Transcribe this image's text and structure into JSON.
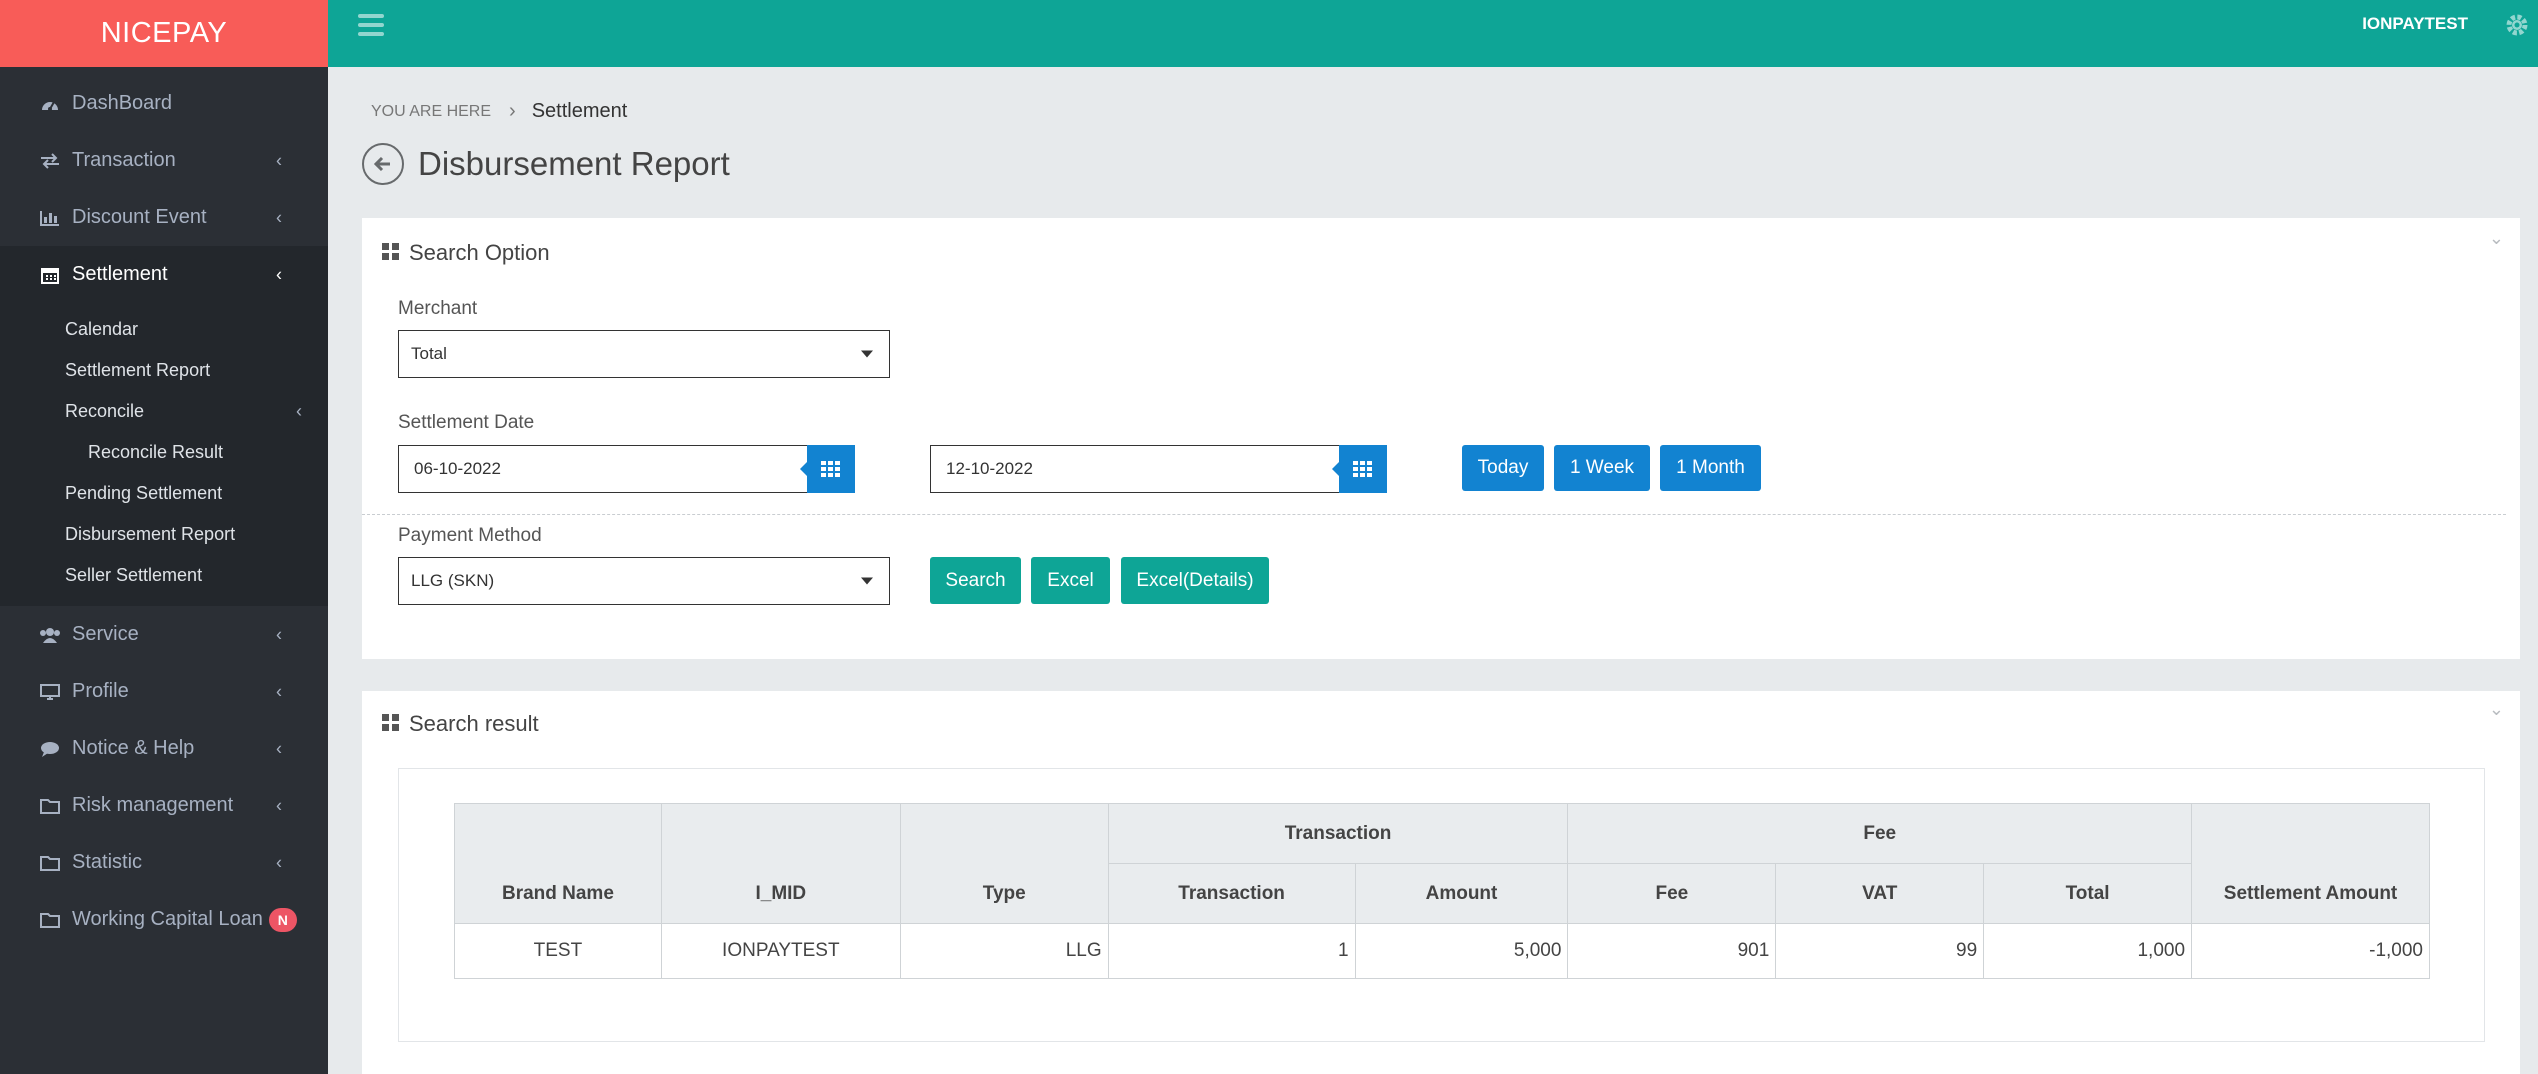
{
  "app": {
    "logo": "NICEPAY",
    "user": "IONPAYTEST"
  },
  "sidebar": {
    "items": [
      {
        "label": "DashBoard",
        "icon": "dashboard-icon"
      },
      {
        "label": "Transaction",
        "icon": "exchange-icon"
      },
      {
        "label": "Discount Event",
        "icon": "bar-chart-icon"
      },
      {
        "label": "Settlement",
        "icon": "calendar-icon"
      },
      {
        "label": "Service",
        "icon": "users-icon"
      },
      {
        "label": "Profile",
        "icon": "desktop-icon"
      },
      {
        "label": "Notice & Help",
        "icon": "comment-icon"
      },
      {
        "label": "Risk management",
        "icon": "folder-icon"
      },
      {
        "label": "Statistic",
        "icon": "folder-icon"
      },
      {
        "label": "Working Capital Loan",
        "icon": "folder-icon",
        "badge": "N"
      }
    ],
    "settlement_sub": [
      {
        "label": "Calendar"
      },
      {
        "label": "Settlement Report"
      },
      {
        "label": "Reconcile"
      },
      {
        "label": "Reconcile Result"
      },
      {
        "label": "Pending Settlement"
      },
      {
        "label": "Disbursement Report"
      },
      {
        "label": "Seller Settlement"
      }
    ]
  },
  "breadcrumb": {
    "prefix": "YOU ARE HERE",
    "current": "Settlement"
  },
  "page": {
    "title": "Disbursement Report"
  },
  "search_option": {
    "title": "Search Option",
    "merchant_label": "Merchant",
    "merchant_value": "Total",
    "date_label": "Settlement Date",
    "date_from": "06-10-2022",
    "date_to": "12-10-2022",
    "quick_buttons": [
      "Today",
      "1 Week",
      "1 Month"
    ],
    "payment_label": "Payment Method",
    "payment_value": "LLG (SKN)",
    "search_btn": "Search",
    "excel_btn": "Excel",
    "excel_details_btn": "Excel(Details)"
  },
  "result": {
    "title": "Search result",
    "headers": {
      "brand": "Brand Name",
      "mid": "I_MID",
      "type": "Type",
      "transaction_group": "Transaction",
      "fee_group": "Fee",
      "transaction": "Transaction",
      "amount": "Amount",
      "fee": "Fee",
      "vat": "VAT",
      "total": "Total",
      "settlement": "Settlement Amount"
    },
    "rows": [
      {
        "brand": "TEST",
        "mid": "IONPAYTEST",
        "type": "LLG",
        "transaction": "1",
        "amount": "5,000",
        "fee": "901",
        "vat": "99",
        "total": "1,000",
        "settlement": "-1,000"
      }
    ]
  },
  "colors": {
    "sidebar": "#2b2f35",
    "logo": "#f85c58",
    "topbar": "#0ea596",
    "primary_blue": "#1283d1",
    "teal": "#0ea596",
    "badge": "#ed5565"
  }
}
